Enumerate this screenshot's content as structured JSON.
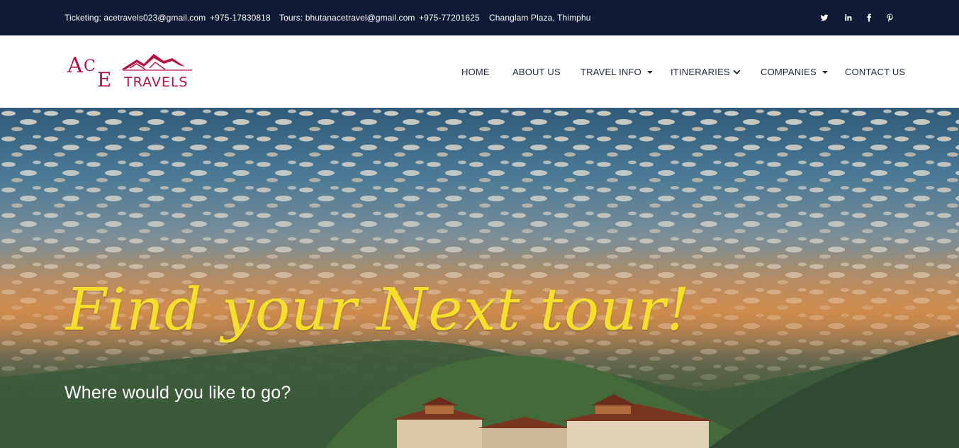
{
  "topbar": {
    "ticketing": "Ticketing: acetravels023@gmail.com",
    "phone1": "+975-17830818",
    "tours": "Tours: bhutanacetravel@gmail.com",
    "phone2": "+975-77201625",
    "address": "Changlam Plaza, Thimphu",
    "social": [
      "twitter-icon",
      "linkedin-icon",
      "facebook-icon",
      "pinterest-icon"
    ]
  },
  "nav": {
    "logo_icon": "ace-travels-logo",
    "items": [
      {
        "label": "HOME"
      },
      {
        "label": "ABOUT US"
      },
      {
        "label": "TRAVEL INFO",
        "icon": "caret-down-icon"
      },
      {
        "label": "ITINERARIES",
        "icon": "chevron-down-icon"
      },
      {
        "label": "COMPANIES",
        "icon": "caret-down-icon"
      },
      {
        "label": "CONTACT US"
      }
    ]
  },
  "hero": {
    "headline": "Find your Next tour!",
    "subheadline": "Where would you like to go?"
  },
  "colors": {
    "topbar": "#0f1a36",
    "logo": "#b5123f",
    "headline": "#f6df2c",
    "nav_text": "#1d2a3c"
  }
}
